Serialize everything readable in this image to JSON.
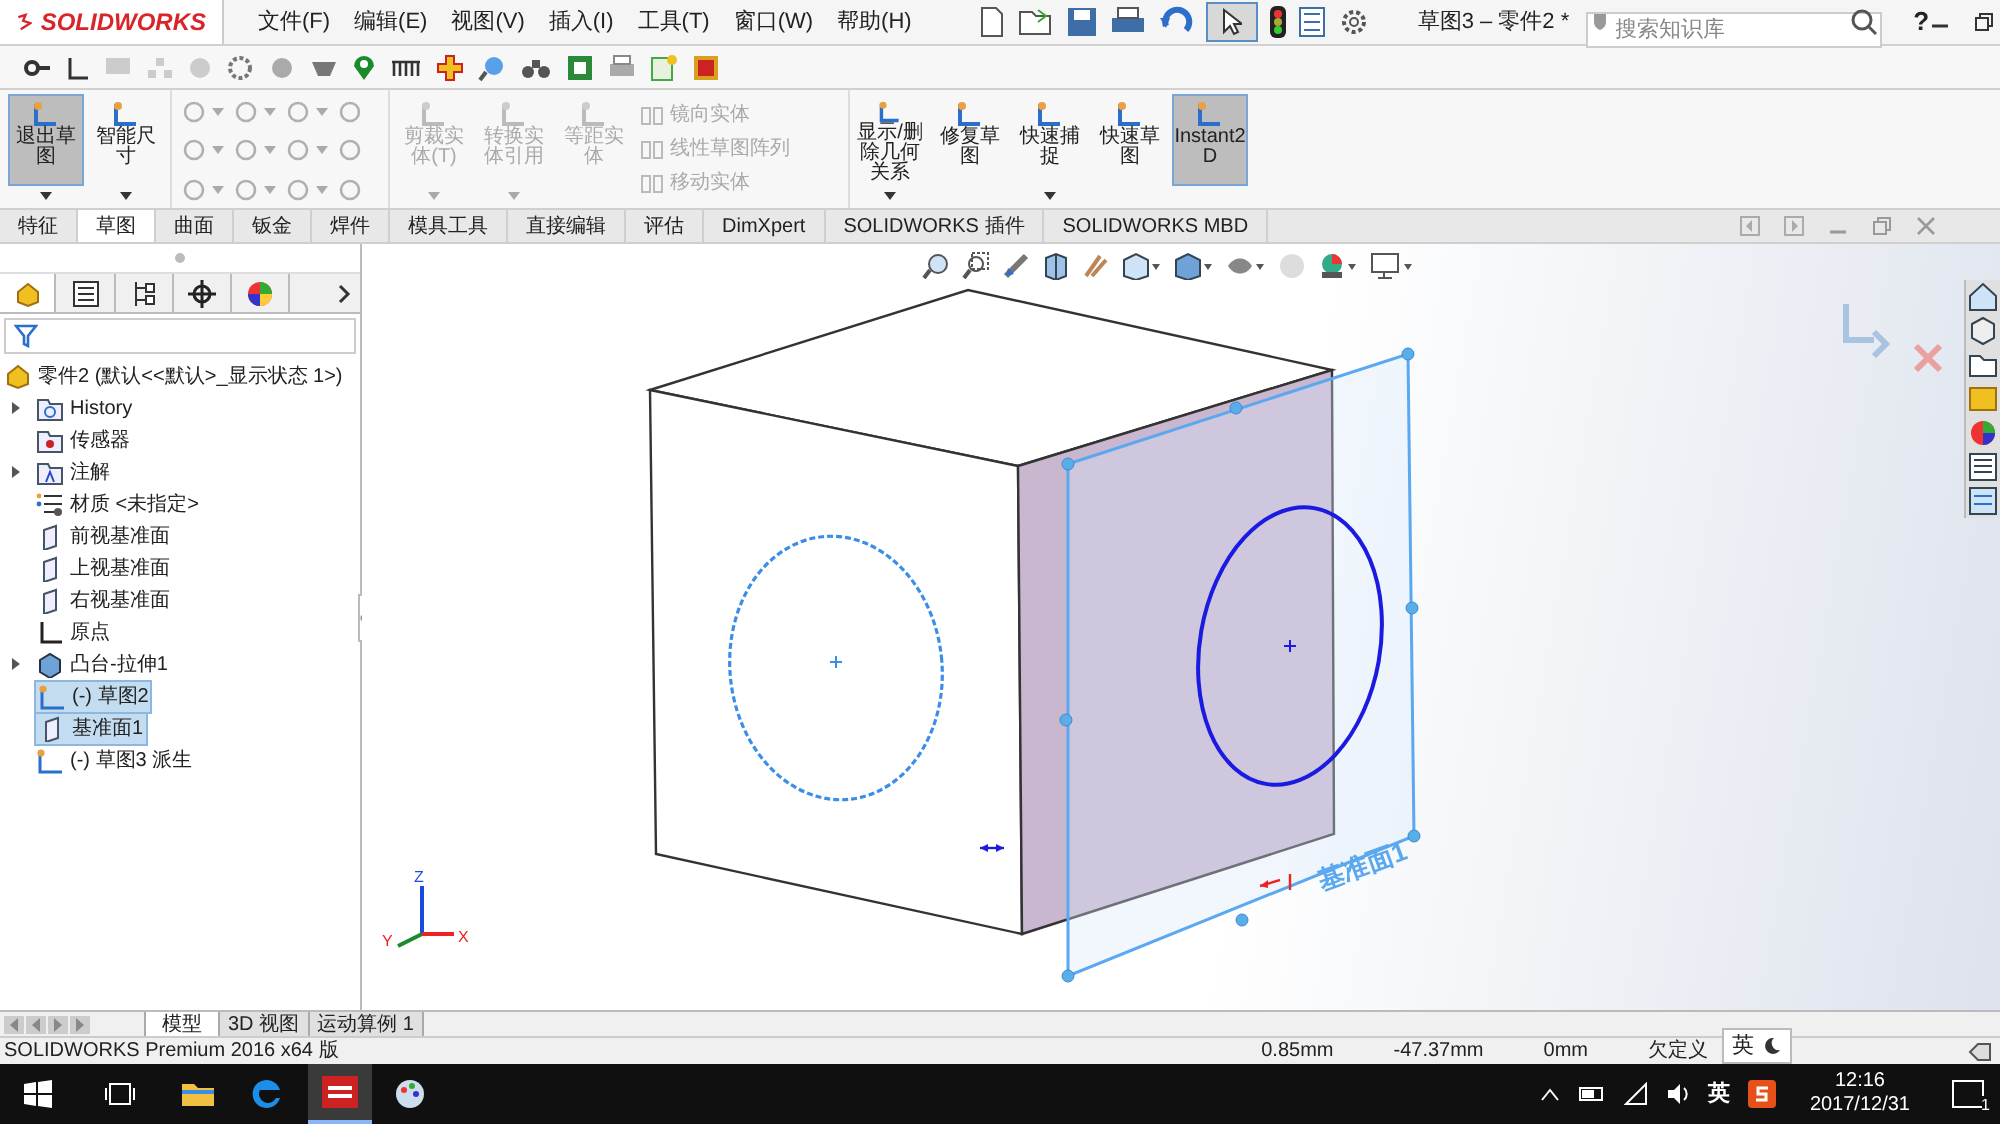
{
  "title_bar": {
    "logo": "SOLIDWORKS",
    "menus": [
      "文件(F)",
      "编辑(E)",
      "视图(V)",
      "插入(I)",
      "工具(T)",
      "窗口(W)",
      "帮助(H)"
    ],
    "document_title": "草图3 – 零件2 *",
    "search": {
      "placeholder": "搜索知识库"
    },
    "help": "?"
  },
  "command_manager": [
    {
      "kind": "large",
      "label": "退出草图",
      "selected": true,
      "disabled": false,
      "dropdown": true
    },
    {
      "kind": "large",
      "label": "智能尺寸",
      "selected": false,
      "disabled": false,
      "dropdown": true
    },
    {
      "kind": "entity-grid"
    },
    {
      "kind": "large",
      "label": "剪裁实体(T)",
      "selected": false,
      "disabled": true,
      "dropdown": true
    },
    {
      "kind": "large",
      "label": "转换实体引用",
      "selected": false,
      "disabled": true,
      "dropdown": true
    },
    {
      "kind": "large",
      "label": "等距实体",
      "selected": false,
      "disabled": true,
      "dropdown": false
    },
    {
      "kind": "stack",
      "items": [
        {
          "label": "镜向实体",
          "disabled": true
        },
        {
          "label": "线性草图阵列",
          "disabled": true
        },
        {
          "label": "移动实体",
          "disabled": true
        }
      ]
    },
    {
      "kind": "large",
      "label": "显示/删除几何关系",
      "selected": false,
      "disabled": false,
      "dropdown": true
    },
    {
      "kind": "large",
      "label": "修复草图",
      "selected": false,
      "disabled": false,
      "dropdown": false
    },
    {
      "kind": "large",
      "label": "快速捕捉",
      "selected": false,
      "disabled": false,
      "dropdown": true
    },
    {
      "kind": "large",
      "label": "快速草图",
      "selected": false,
      "disabled": false,
      "dropdown": false
    },
    {
      "kind": "large",
      "label": "Instant2D",
      "selected": true,
      "disabled": false,
      "dropdown": false
    }
  ],
  "tabs": [
    {
      "label": "特征",
      "selected": false
    },
    {
      "label": "草图",
      "selected": true
    },
    {
      "label": "曲面",
      "selected": false
    },
    {
      "label": "钣金",
      "selected": false
    },
    {
      "label": "焊件",
      "selected": false
    },
    {
      "label": "模具工具",
      "selected": false
    },
    {
      "label": "直接编辑",
      "selected": false
    },
    {
      "label": "评估",
      "selected": false
    },
    {
      "label": "DimXpert",
      "selected": false
    },
    {
      "label": "SOLIDWORKS 插件",
      "selected": false
    },
    {
      "label": "SOLIDWORKS MBD",
      "selected": false
    }
  ],
  "feature_tree": {
    "root": "零件2  (默认<<默认>_显示状态 1>)",
    "items": [
      {
        "label": "History",
        "kind": "history",
        "expander": true,
        "selected": false
      },
      {
        "label": "传感器",
        "kind": "sensor",
        "expander": false,
        "selected": false
      },
      {
        "label": "注解",
        "kind": "annotation",
        "expander": true,
        "selected": false
      },
      {
        "label": "材质 <未指定>",
        "kind": "material",
        "expander": false,
        "selected": false
      },
      {
        "label": "前视基准面",
        "kind": "plane",
        "expander": false,
        "selected": false
      },
      {
        "label": "上视基准面",
        "kind": "plane",
        "expander": false,
        "selected": false
      },
      {
        "label": "右视基准面",
        "kind": "plane",
        "expander": false,
        "selected": false
      },
      {
        "label": "原点",
        "kind": "origin",
        "expander": false,
        "selected": false
      },
      {
        "label": "凸台-拉伸1",
        "kind": "extrude",
        "expander": true,
        "selected": false
      },
      {
        "label": "(-) 草图2",
        "kind": "sketch",
        "expander": false,
        "selected": true
      },
      {
        "label": "基准面1",
        "kind": "plane",
        "expander": false,
        "selected": true
      },
      {
        "label": "(-) 草图3 派生",
        "kind": "sketch",
        "expander": false,
        "selected": false
      }
    ]
  },
  "viewport": {
    "plane_label": "基准面1",
    "triad_labels": [
      "X",
      "Y",
      "Z"
    ]
  },
  "bottom_tabs": [
    {
      "label": "模型",
      "selected": true
    },
    {
      "label": "3D 视图",
      "selected": false
    },
    {
      "label": "运动算例 1",
      "selected": false
    }
  ],
  "status_bar": {
    "product": "SOLIDWORKS Premium 2016 x64 版",
    "readouts": [
      "0.85mm",
      "-47.37mm",
      "0mm",
      "欠定义"
    ]
  },
  "ime_bar": {
    "label": "英"
  },
  "taskbar": {
    "ime": "英",
    "time": "12:16",
    "date": "2017/12/31",
    "notifications": "1"
  }
}
